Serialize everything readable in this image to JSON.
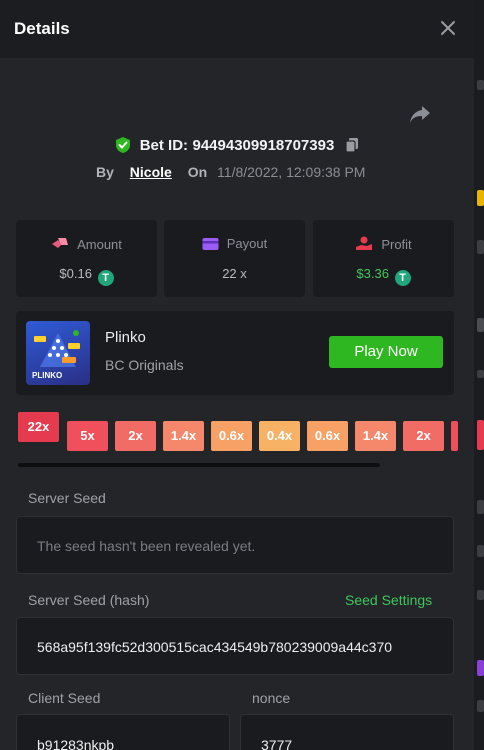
{
  "header": {
    "title": "Details"
  },
  "bet": {
    "id_label": "Bet ID:",
    "id_value": "94494309918707393",
    "by_label": "By",
    "user": "Nicole",
    "on_label": "On",
    "datetime": "11/8/2022, 12:09:38 PM"
  },
  "stats": {
    "amount": {
      "label": "Amount",
      "value": "$0.16",
      "coin": "T"
    },
    "payout": {
      "label": "Payout",
      "value": "22 x"
    },
    "profit": {
      "label": "Profit",
      "value": "$3.36",
      "coin": "T"
    }
  },
  "game": {
    "name": "Plinko",
    "provider": "BC Originals",
    "thumb_text": "PLINKO",
    "play_label": "Play Now"
  },
  "multipliers": {
    "hit": "22x",
    "items": [
      "5x",
      "2x",
      "1.4x",
      "0.6x",
      "0.4x",
      "0.6x",
      "1.4x",
      "2x"
    ]
  },
  "seeds": {
    "server_seed_label": "Server Seed",
    "server_seed_placeholder": "The seed hasn't been revealed yet.",
    "server_hash_label": "Server Seed (hash)",
    "seed_settings_label": "Seed Settings",
    "server_hash_value": "568a95f139fc52d300515cac434549b780239009a44c370",
    "client_seed_label": "Client Seed",
    "client_seed_value": "b91283nkpb",
    "nonce_label": "nonce",
    "nonce_value": "3777"
  },
  "colors": {
    "accent_green": "#2fb722",
    "profit_green": "#3ec75d",
    "hit_red": "#e63b4e",
    "coin": "#1fa67a"
  }
}
